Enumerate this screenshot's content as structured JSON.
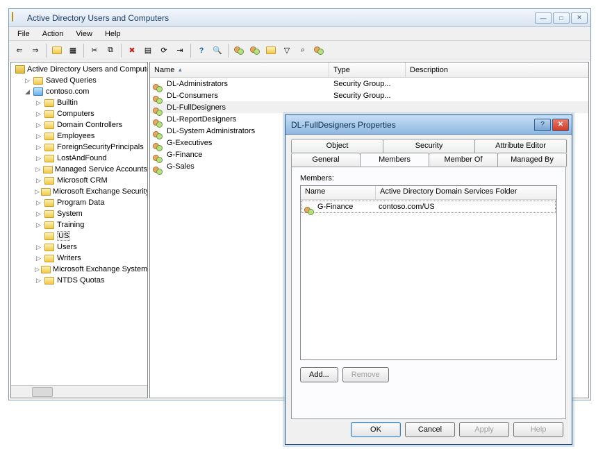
{
  "window": {
    "title": "Active Directory Users and Computers"
  },
  "menu": {
    "file": "File",
    "action": "Action",
    "view": "View",
    "help": "Help"
  },
  "tree": {
    "root": "Active Directory Users and Computers",
    "saved": "Saved Queries",
    "domain": "contoso.com",
    "items": [
      "Builtin",
      "Computers",
      "Domain Controllers",
      "Employees",
      "ForeignSecurityPrincipals",
      "LostAndFound",
      "Managed Service Accounts",
      "Microsoft CRM",
      "Microsoft Exchange Security Groups",
      "Program Data",
      "System",
      "Training",
      "US",
      "Users",
      "Writers",
      "Microsoft Exchange System Objects",
      "NTDS Quotas"
    ],
    "selected": "US"
  },
  "list": {
    "cols": {
      "name": "Name",
      "type": "Type",
      "desc": "Description"
    },
    "rows": [
      {
        "name": "DL-Administrators",
        "type": "Security Group..."
      },
      {
        "name": "DL-Consumers",
        "type": "Security Group..."
      },
      {
        "name": "DL-FullDesigners",
        "type": ""
      },
      {
        "name": "DL-ReportDesigners",
        "type": ""
      },
      {
        "name": "DL-System Administrators",
        "type": ""
      },
      {
        "name": "G-Executives",
        "type": ""
      },
      {
        "name": "G-Finance",
        "type": ""
      },
      {
        "name": "G-Sales",
        "type": ""
      }
    ],
    "selected": "DL-FullDesigners"
  },
  "dialog": {
    "title": "DL-FullDesigners Properties",
    "tabs": {
      "object": "Object",
      "security": "Security",
      "attr": "Attribute Editor",
      "general": "General",
      "members": "Members",
      "memberof": "Member Of",
      "managedby": "Managed By"
    },
    "activeTab": "Members",
    "membersLabel": "Members:",
    "memberCols": {
      "name": "Name",
      "folder": "Active Directory Domain Services Folder"
    },
    "memberRows": [
      {
        "name": "G-Finance",
        "folder": "contoso.com/US"
      }
    ],
    "buttons": {
      "add": "Add...",
      "remove": "Remove",
      "ok": "OK",
      "cancel": "Cancel",
      "apply": "Apply",
      "help": "Help"
    }
  }
}
